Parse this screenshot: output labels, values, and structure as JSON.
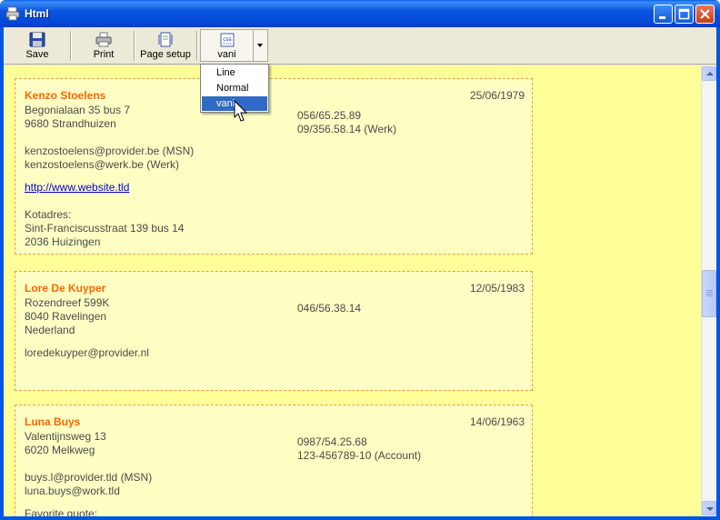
{
  "window": {
    "title": "Html"
  },
  "toolbar": {
    "save_label": "Save",
    "print_label": "Print",
    "page_setup_label": "Page setup",
    "css_label": "vani",
    "css_icon_text": "css"
  },
  "css_menu": {
    "items": [
      "Line",
      "Normal",
      "vani"
    ],
    "selected": "vani"
  },
  "contacts": [
    {
      "name": "Kenzo Stoelens",
      "date": "25/06/1979",
      "address": [
        "Begonialaan 35 bus 7",
        "9680 Strandhuizen"
      ],
      "phones": [
        "056/65.25.89",
        "09/356.58.14 (Werk)"
      ],
      "emails": [
        "kenzostoelens@provider.be (MSN)",
        "kenzostoelens@werk.be (Werk)"
      ],
      "website": "http://www.website.tld",
      "extra_label": "Kotadres:",
      "extra": [
        "Sint-Franciscusstraat 139 bus 14",
        "2036 Huizingen"
      ]
    },
    {
      "name": "Lore De Kuyper",
      "date": "12/05/1983",
      "address": [
        "Rozendreef 599K",
        "8040 Ravelingen",
        "Nederland"
      ],
      "phones": [
        "046/56.38.14"
      ],
      "emails": [
        "loredekuyper@provider.nl"
      ]
    },
    {
      "name": "Luna Buys",
      "date": "14/06/1963",
      "address": [
        "Valentijnsweg 13",
        "6020 Melkweg"
      ],
      "phones": [
        "0987/54.25.68",
        "123-456789-10 (Account)"
      ],
      "emails": [
        "buys.l@provider.tld (MSN)",
        "luna.buys@work.tld"
      ],
      "extra_label": "Favorite quote:"
    }
  ]
}
